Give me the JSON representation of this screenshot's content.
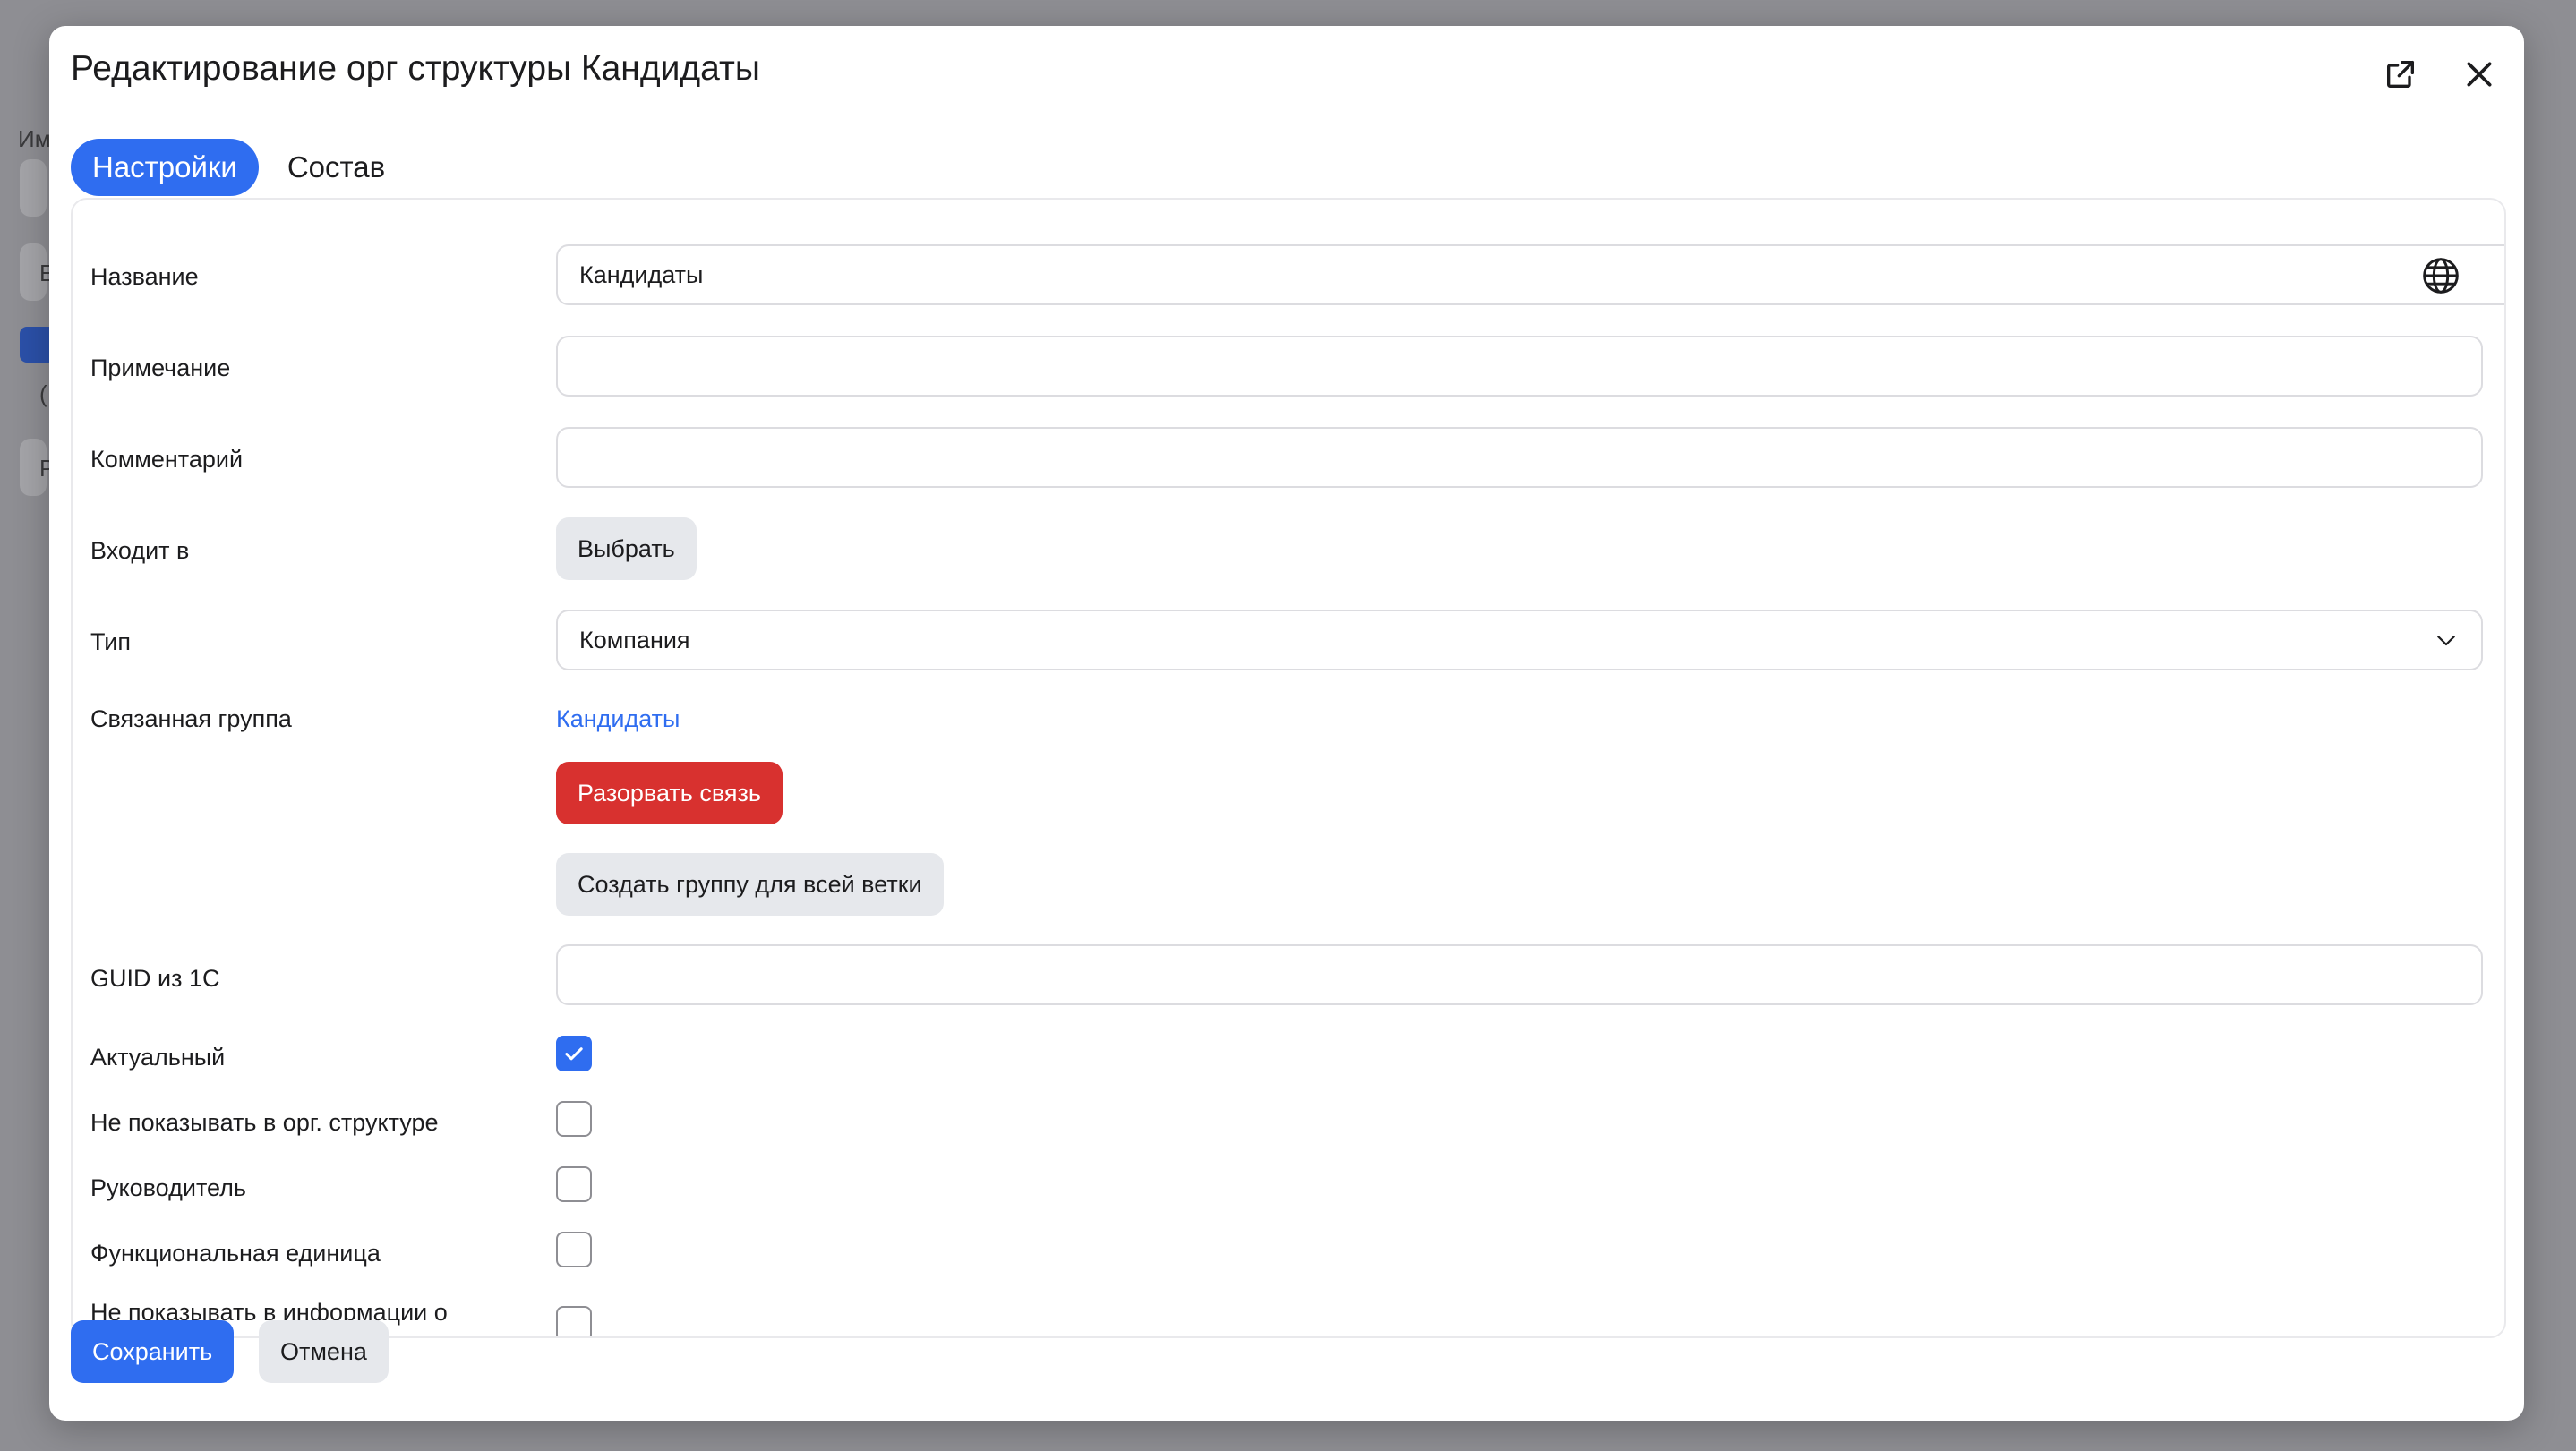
{
  "background": {
    "fragments": [
      "Им",
      "E",
      "(",
      "Р"
    ]
  },
  "modal": {
    "title": "Редактирование орг структуры Кандидаты",
    "open_external_icon": "open-external-icon",
    "close_icon": "close-icon"
  },
  "tabs": [
    {
      "label": "Настройки",
      "active": true
    },
    {
      "label": "Состав",
      "active": false
    }
  ],
  "form": {
    "name_label": "Название",
    "name_value": "Кандидаты",
    "note_label": "Примечание",
    "note_value": "",
    "comment_label": "Комментарий",
    "comment_value": "",
    "parent_label": "Входит в",
    "parent_button": "Выбрать",
    "type_label": "Тип",
    "type_value": "Компания",
    "linked_group_label": "Связанная группа",
    "linked_group_link": "Кандидаты",
    "break_link_button": "Разорвать связь",
    "create_group_button": "Создать группу для всей ветки",
    "guid_label": "GUID из 1С",
    "guid_value": "",
    "actual_label": "Актуальный",
    "actual_checked": true,
    "hide_in_org_label": "Не показывать в орг. структуре",
    "hide_in_org_checked": false,
    "manager_label": "Руководитель",
    "manager_checked": false,
    "functional_unit_label": "Функциональная единица",
    "functional_unit_checked": false,
    "hide_in_info_label": "Не показывать в информации о",
    "hide_in_info_checked": false
  },
  "footer": {
    "save_button": "Сохранить",
    "cancel_button": "Отмена"
  },
  "colors": {
    "accent": "#2f6df0",
    "danger": "#d8312f",
    "neutral_button": "#e6e8ec"
  }
}
